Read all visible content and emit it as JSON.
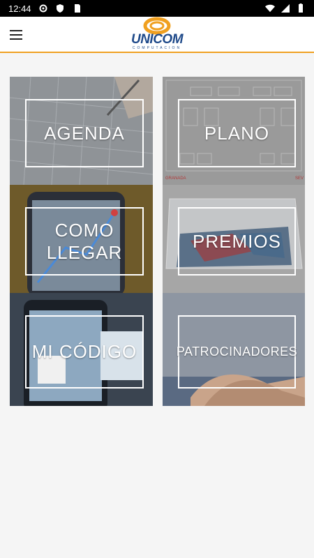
{
  "status": {
    "time": "12:44"
  },
  "header": {
    "logo_text": "UNICOM",
    "logo_sub": "COMPUTACION"
  },
  "tiles": [
    {
      "label": "AGENDA"
    },
    {
      "label": "PLANO"
    },
    {
      "label": "COMO LLEGAR"
    },
    {
      "label": "PREMIOS"
    },
    {
      "label": "MI CÓDIGO"
    },
    {
      "label": "PATROCINADORES"
    }
  ],
  "plan_labels": {
    "left": "GRANADA",
    "right": "SEV"
  },
  "colors": {
    "accent": "#f0a020",
    "brand": "#1f4a8a"
  }
}
